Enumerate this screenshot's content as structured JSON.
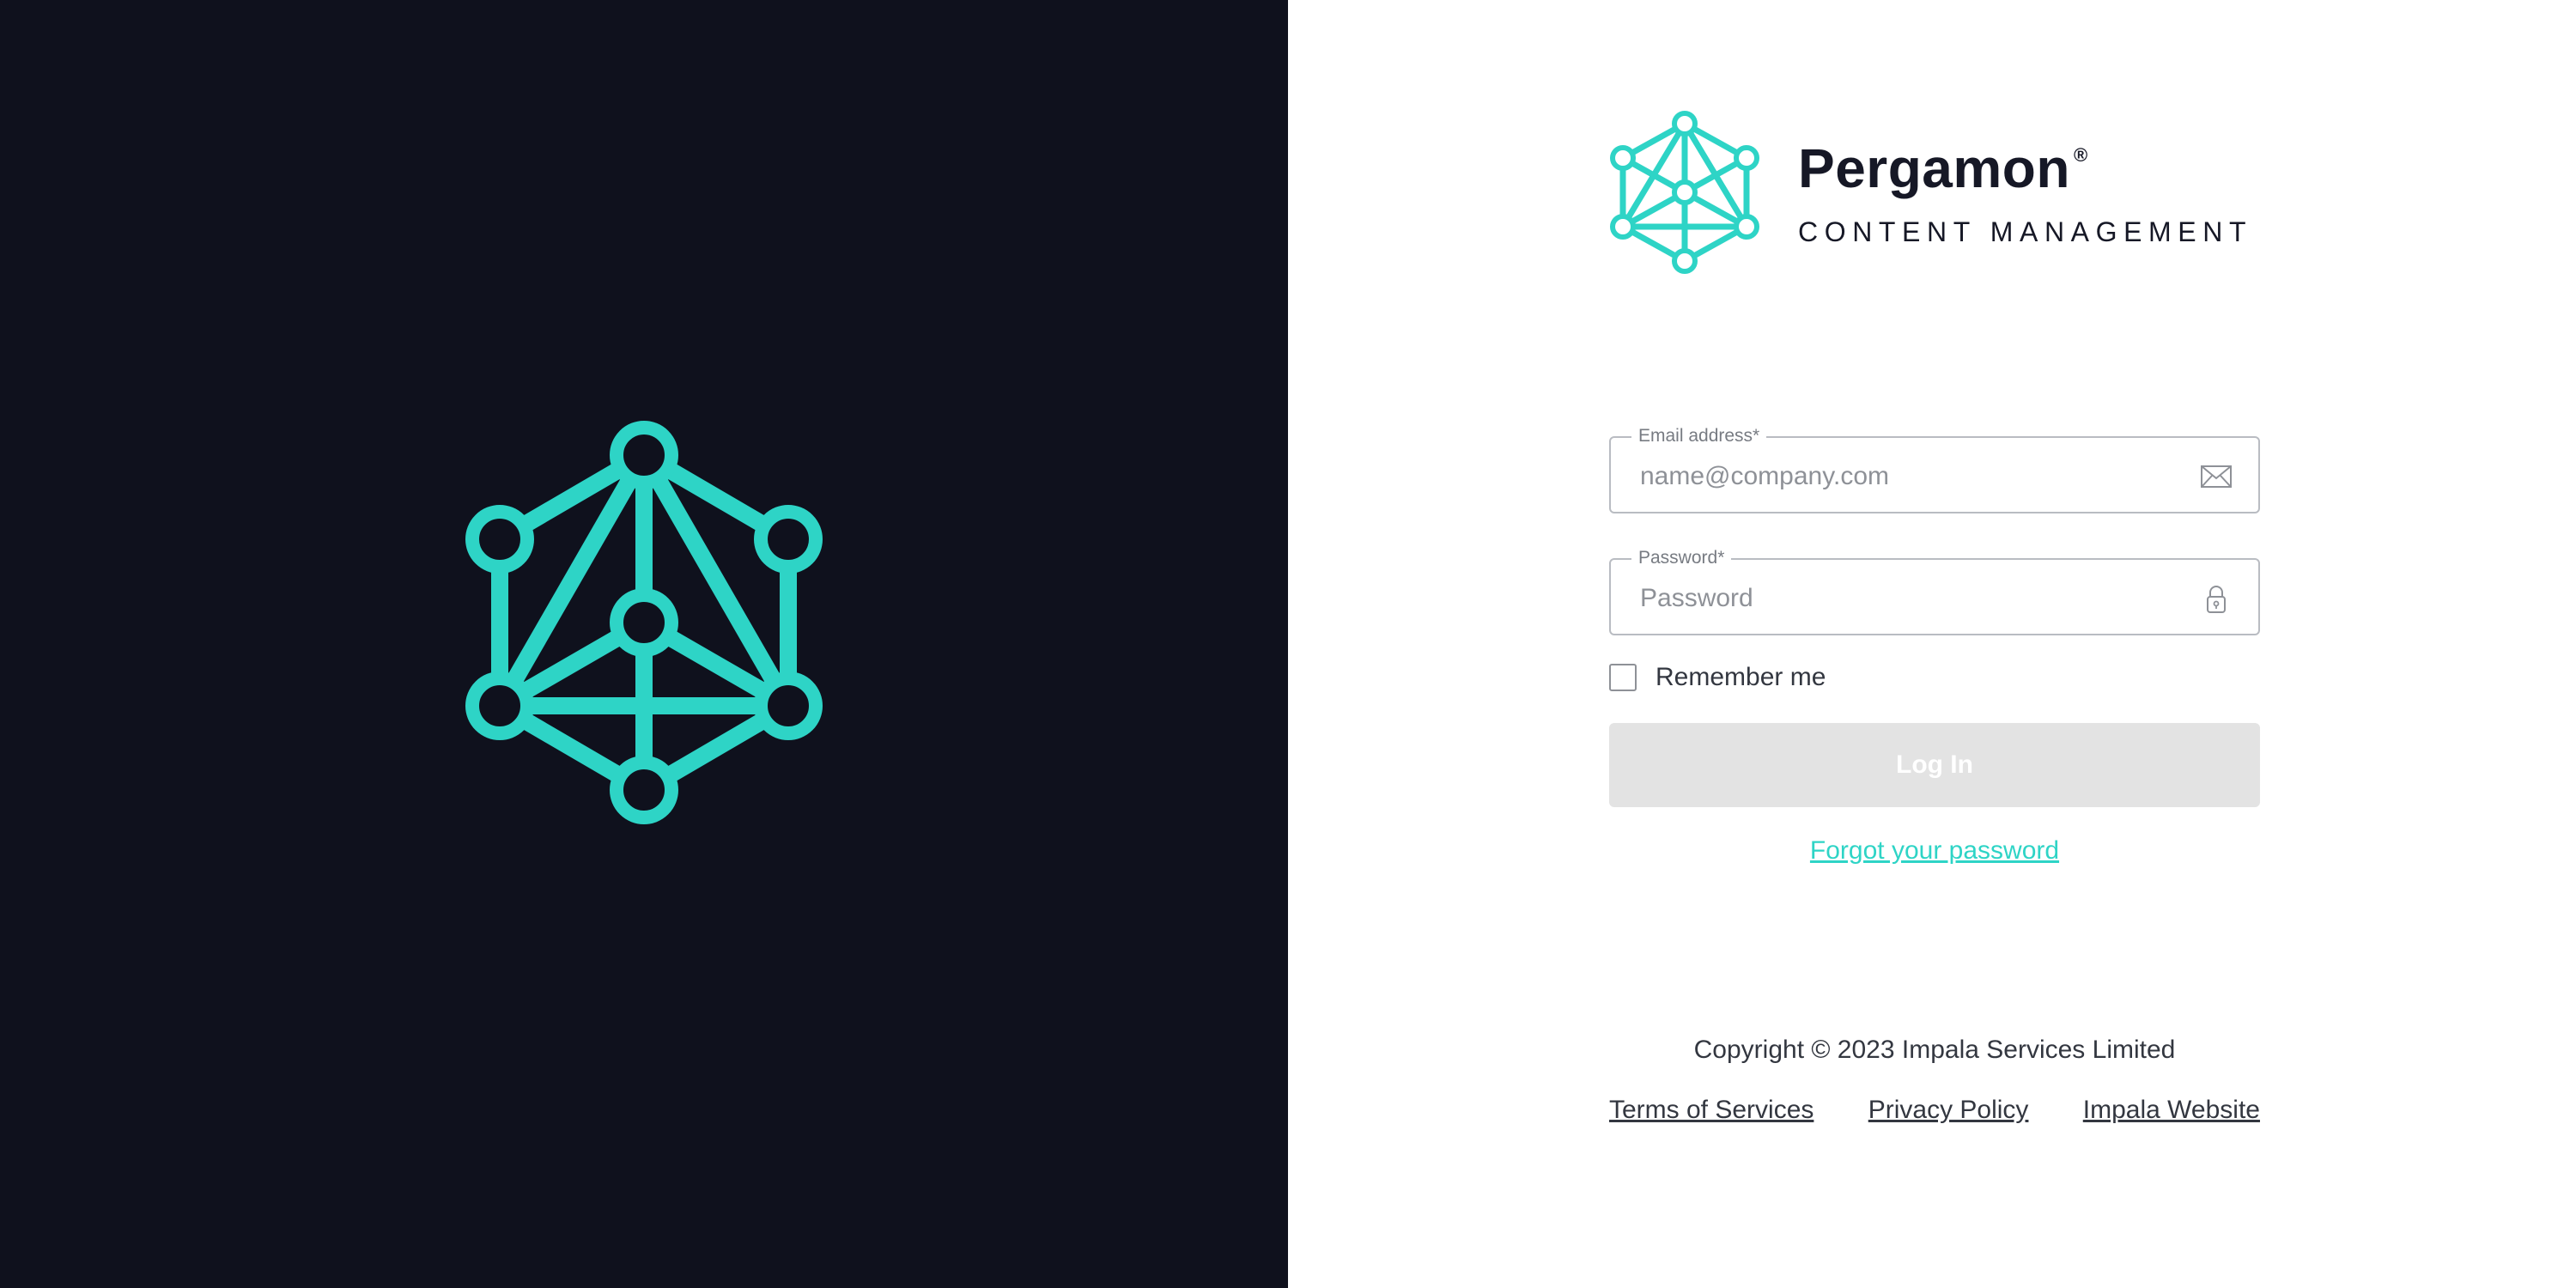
{
  "brand": {
    "name": "Pergamon",
    "registered": "®",
    "subtitle": "CONTENT MANAGEMENT",
    "accent_color": "#2ed4c6",
    "logo_icon": "network-hexagon-icon"
  },
  "left_panel": {
    "background": "#0f111d",
    "logo_icon": "network-hexagon-icon"
  },
  "form": {
    "email": {
      "label": "Email address*",
      "placeholder": "name@company.com",
      "value": "",
      "icon": "envelope-icon"
    },
    "password": {
      "label": "Password*",
      "placeholder": "Password",
      "value": "",
      "icon": "lock-icon"
    },
    "remember_label": "Remember me",
    "remember_checked": false,
    "login_label": "Log In",
    "forgot_label": "Forgot your password"
  },
  "footer": {
    "copyright": "Copyright © 2023 Impala Services Limited",
    "links": [
      "Terms of Services",
      "Privacy Policy",
      "Impala Website"
    ]
  }
}
